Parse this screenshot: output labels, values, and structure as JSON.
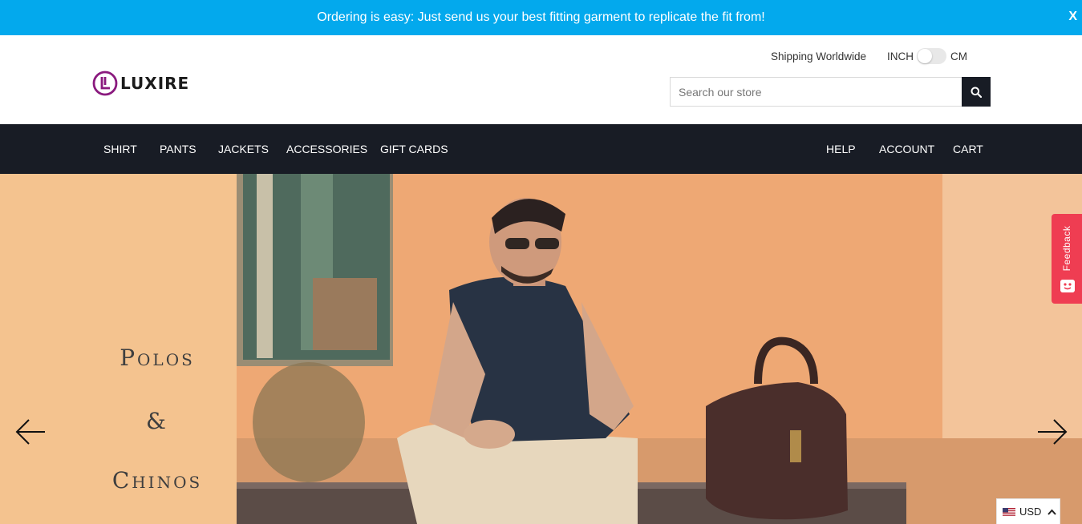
{
  "announcement": {
    "text": "Ordering is easy: Just send us your best fitting garment to replicate the fit from!",
    "close_label": "X"
  },
  "header": {
    "logo_text": "LUXIRE",
    "shipping": "Shipping Worldwide",
    "unit_left": "INCH",
    "unit_right": "CM",
    "search": {
      "placeholder": "Search our store",
      "button_icon": "search-icon"
    }
  },
  "nav": {
    "left": [
      {
        "label": "SHIRT"
      },
      {
        "label": "PANTS"
      },
      {
        "label": "JACKETS"
      },
      {
        "label": "ACCESSORIES"
      },
      {
        "label": "GIFT CARDS"
      }
    ],
    "right": [
      {
        "label": "HELP"
      },
      {
        "label": "ACCOUNT"
      },
      {
        "label": "CART"
      }
    ]
  },
  "hero": {
    "line1": "Polos",
    "line2": "&",
    "line3": "Chinos",
    "prev_icon": "arrow-left-icon",
    "next_icon": "arrow-right-icon"
  },
  "feedback": {
    "label": "Feedback"
  },
  "currency": {
    "code": "USD",
    "flag_icon": "us-flag-icon",
    "chevron_icon": "chevron-up-icon"
  },
  "colors": {
    "announcement_bg": "#03a9ed",
    "nav_bg": "#181c25",
    "brand_purple": "#8a1a7e",
    "hero_bg": "#f4c38f",
    "feedback_bg": "#ef3d52"
  }
}
